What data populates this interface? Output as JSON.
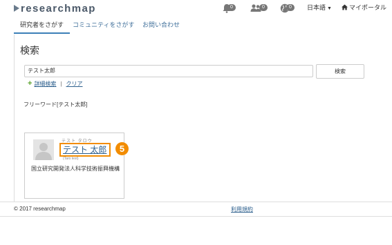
{
  "header": {
    "logo_text": "researchmap",
    "badges": [
      "0",
      "0",
      "0"
    ],
    "language_label": "日本語",
    "mypage_label": "マイポータル"
  },
  "nav": {
    "tabs": [
      {
        "label": "研究者をさがす",
        "active": true
      },
      {
        "label": "コミュニティをさがす",
        "active": false
      },
      {
        "label": "お問い合わせ",
        "active": false
      }
    ]
  },
  "main": {
    "title": "検索",
    "search_value": "テスト太郎",
    "search_button": "検索",
    "advanced_label": "詳細検索",
    "link_separator": "|",
    "clear_label": "クリア",
    "freeword_text": "フリーワード[テスト太郎]"
  },
  "result": {
    "kana": "テスト タロウ",
    "name": "テスト 太郎",
    "roman": "(Taro test)",
    "affiliation": "国立研究開発法人科学技術振興機構",
    "callout_number": "5"
  },
  "footer": {
    "copyright": "© 2017 researchmap",
    "terms": "利用規約"
  },
  "colors": {
    "link": "#2b5e8c",
    "accent": "#f28c00",
    "active_tab": "#3b7fb7"
  }
}
